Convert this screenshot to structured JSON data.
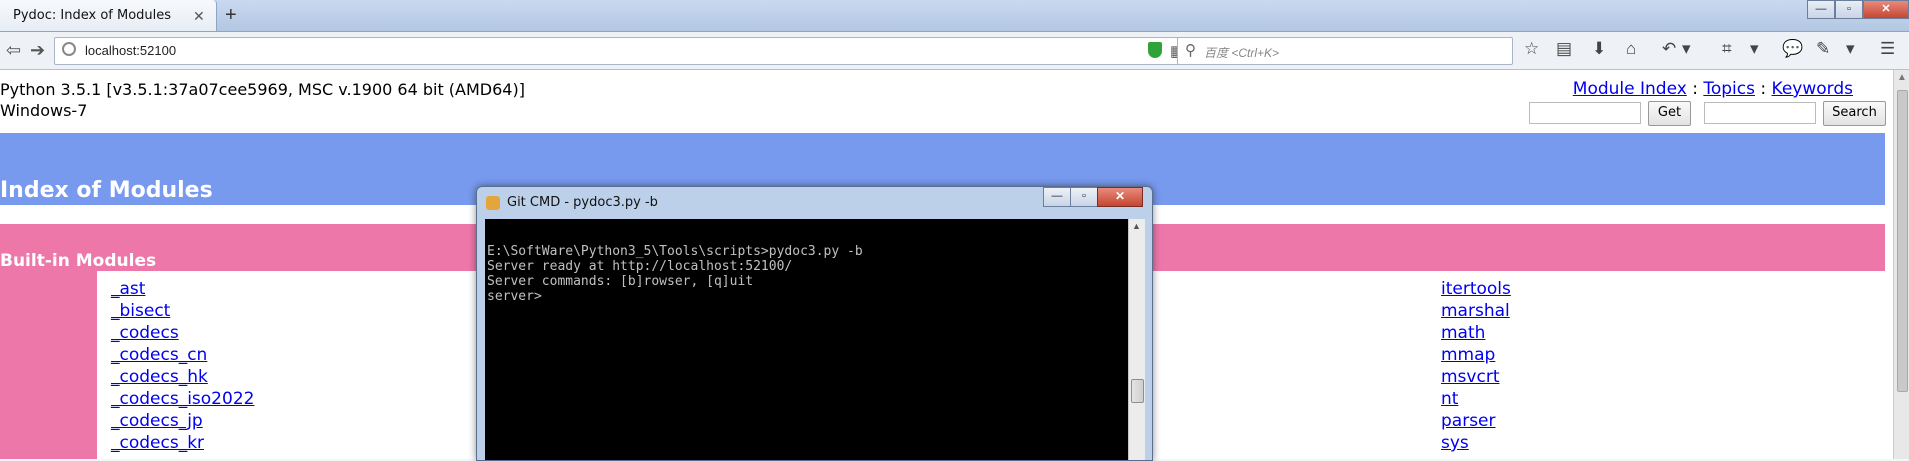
{
  "browser": {
    "tab_title": "Pydoc: Index of Modules",
    "tab_close": "✕",
    "new_tab": "+",
    "window_controls": {
      "minimize": "—",
      "maximize": "▫",
      "close": "✕"
    },
    "url": "localhost:52100",
    "search_placeholder": "百度 <Ctrl+K>"
  },
  "page": {
    "version": "Python 3.5.1 [v3.5.1:37a07cee5969, MSC v.1900 64 bit (AMD64)]",
    "os": "Windows-7",
    "links": {
      "module_index": "Module Index",
      "topics": "Topics",
      "keywords": "Keywords",
      "separator": " : "
    },
    "get_button": "Get",
    "search_button": "Search",
    "index_title": "Index of Modules",
    "builtin_title": "Built-in Modules",
    "modules_left": [
      "_ast",
      "_bisect",
      "_codecs",
      "_codecs_cn",
      "_codecs_hk",
      "_codecs_iso2022",
      "_codecs_jp",
      "_codecs_kr"
    ],
    "modules_right": [
      "itertools",
      "marshal",
      "math",
      "mmap",
      "msvcrt",
      "nt",
      "parser",
      "sys"
    ]
  },
  "cmd": {
    "title": "Git CMD - pydoc3.py  -b",
    "lines": [
      "E:\\SoftWare\\Python3_5\\Tools\\scripts>pydoc3.py -b",
      "Server ready at http://localhost:52100/",
      "Server commands: [b]rowser, [q]uit",
      "server>"
    ]
  }
}
